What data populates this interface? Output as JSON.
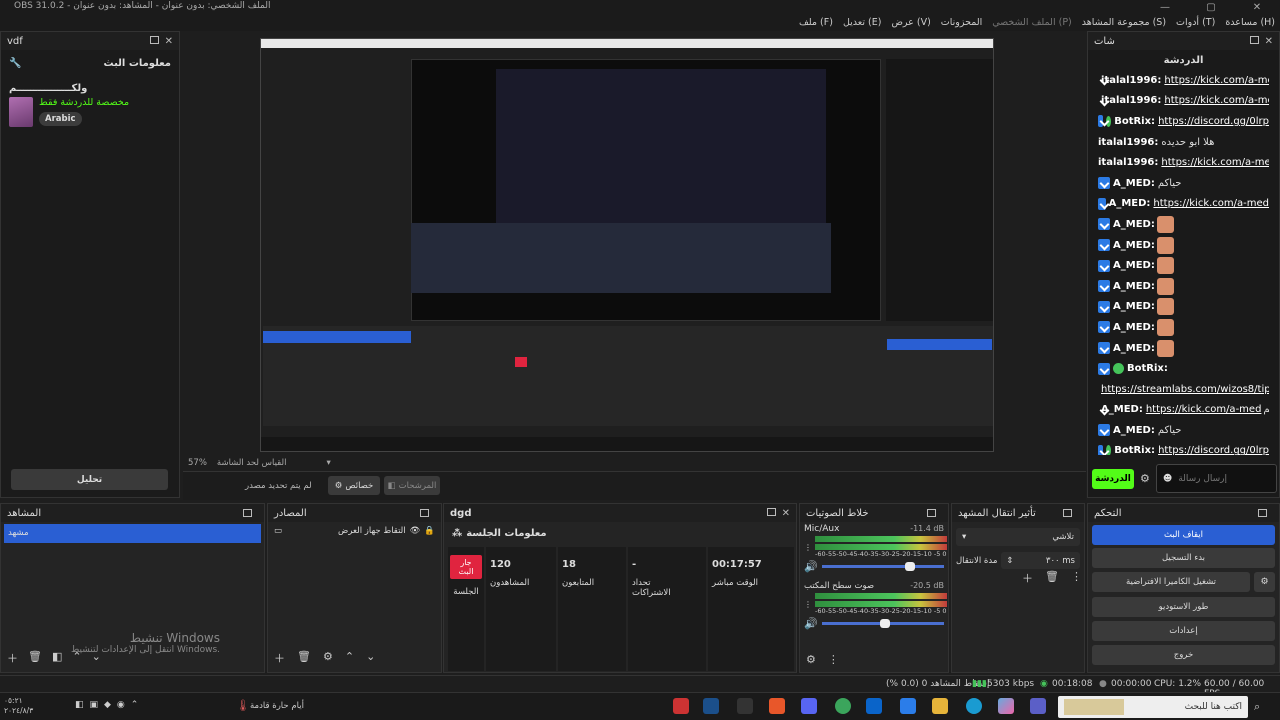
{
  "window": {
    "title": "OBS 31.0.2 - الملف الشخصي: بدون عنوان - المشاهد: بدون عنوان",
    "controls": [
      "—",
      "▢",
      "✕"
    ]
  },
  "menu": [
    {
      "label": "ملف (F)",
      "dim": false
    },
    {
      "label": "تعديل (E)",
      "dim": false
    },
    {
      "label": "عرض (V)",
      "dim": false
    },
    {
      "label": "المحزونات",
      "dim": false
    },
    {
      "label": "الملف الشخصي (P)",
      "dim": true
    },
    {
      "label": "مجموعة المشاهد (S)",
      "dim": false
    },
    {
      "label": "أدوات (T)",
      "dim": false
    },
    {
      "label": "مساعدة (H)",
      "dim": false
    }
  ],
  "left_dock": {
    "title": "vdf",
    "section_title": "معلومات البث",
    "channel_name": "ولكــــــــــــــــم",
    "description": "مخصصة للدردشة فقط",
    "tag": "Arabic",
    "edit_button": "تحليل"
  },
  "preview": {
    "zoom": "57%",
    "zoom_label": "القياس لحد الشاشة",
    "no_source": "لم يتم تحديد مصدر",
    "filters_btn": "خصائص",
    "transitions_btn": "المرشحات"
  },
  "chat": {
    "dock_title": "شات",
    "header": "الدردشة",
    "messages": [
      {
        "badge": "kick",
        "user": "italal1996:",
        "text": "https://kick.com/a-med",
        "link": true
      },
      {
        "badge": "kick",
        "user": "italal1996:",
        "text": "https://kick.com/a-med",
        "link": true
      },
      {
        "badge": "kickv",
        "user": "BotRix:",
        "text": "https://discord.gg/0lrp",
        "link": true
      },
      {
        "badge": "none",
        "user": "italal1996:",
        "text": "هلا ابو حديده",
        "link": false
      },
      {
        "badge": "none",
        "user": "italal1996:",
        "text": "https://kick.com/a-med",
        "link": true
      },
      {
        "badge": "kick",
        "user": "A_MED:",
        "text": "حياكم",
        "link": false
      },
      {
        "badge": "kick",
        "user": "A_MED:",
        "text": "https://kick.com/a-med",
        "link": true
      },
      {
        "badge": "kick",
        "user": "A_MED:",
        "text": "",
        "emote": true
      },
      {
        "badge": "kick",
        "user": "A_MED:",
        "text": "",
        "emote": true
      },
      {
        "badge": "kick",
        "user": "A_MED:",
        "text": "",
        "emote": true
      },
      {
        "badge": "kick",
        "user": "A_MED:",
        "text": "",
        "emote": true
      },
      {
        "badge": "kick",
        "user": "A_MED:",
        "text": "",
        "emote": true
      },
      {
        "badge": "kick",
        "user": "A_MED:",
        "text": "",
        "emote": true
      },
      {
        "badge": "kick",
        "user": "A_MED:",
        "text": "",
        "emote": true
      },
      {
        "badge": "kickv",
        "user": "BotRix:",
        "text": "",
        "link": false
      },
      {
        "badge": "none",
        "user": "",
        "text": "https://streamlabs.com/wizos8/tip",
        "link": true
      },
      {
        "badge": "kick",
        "user": "A_MED:",
        "text": "https://kick.com/a-med",
        "link": true,
        "suffix": "حياكم"
      },
      {
        "badge": "kick",
        "user": "A_MED:",
        "text": "حياكم",
        "link": false
      },
      {
        "badge": "kickv",
        "user": "BotRix:",
        "text": "https://discord.gg/0lrp",
        "link": true
      }
    ],
    "input_placeholder": "إرسال رسالة",
    "send_button": "الدردشة"
  },
  "scenes": {
    "title": "المشاهد",
    "items": [
      "مشهد"
    ]
  },
  "sources": {
    "title": "المصادر",
    "items": [
      "التقاط جهاز العرض"
    ]
  },
  "stats": {
    "title": "dgd",
    "section": "معلومات الجلسة",
    "live_badge": "جار البث",
    "session_label": "الجلسة",
    "items": [
      {
        "value": "120",
        "label": "المشاهدون"
      },
      {
        "value": "18",
        "label": "المتابعون"
      },
      {
        "value": "-",
        "label": "تحداد الاشتراكات"
      },
      {
        "value": "00:17:57",
        "label": "الوقت مباشر"
      }
    ]
  },
  "watermark": {
    "line1": "تنشيط Windows",
    "line2": "انتقل إلى الإعدادات لتنشيط Windows."
  },
  "mixer": {
    "title": "خلاط الصوتيات",
    "channels": [
      {
        "name": "Mic/Aux",
        "db": "-11.4 dB",
        "level": 0.74
      },
      {
        "name": "صوت سطح المكتب",
        "db": "-20.5 dB",
        "level": 0.52
      }
    ],
    "scale": "-60-55-50-45-40-35-30-25-20-15-10 -5 0"
  },
  "transitions": {
    "title": "تأثير انتقال المشهد",
    "selected": "تلاشي",
    "duration_label": "مدة الانتقال",
    "duration": "٣٠٠ ms"
  },
  "controls": {
    "title": "التحكم",
    "buttons": [
      "ايقاف البث",
      "بدء التسجيل",
      "تشغيل الكاميرا الافتراضية",
      "طور الاستوديو",
      "إعدادات",
      "خروج"
    ]
  },
  "status": {
    "dropped": "إسقاط المشاهد 0 (0.0 %)",
    "bitrate": "5303 kbps",
    "live_time": "00:18:08",
    "rec_time": "00:00:00",
    "cpu": "CPU: 1.2%",
    "fps": "60.00 / 60.00 FPS"
  },
  "taskbar": {
    "search_placeholder": "اكتب هنا للبحث",
    "weather": "أيام حارة قادمة",
    "time": "٠٥:٢١",
    "date": "٢٠٢٤/٨/٣"
  },
  "colors": {
    "accent": "#2a5fd3",
    "live": "#e0243f",
    "kick_green": "#53fc18",
    "chat_bg": "#1a1a1a"
  }
}
